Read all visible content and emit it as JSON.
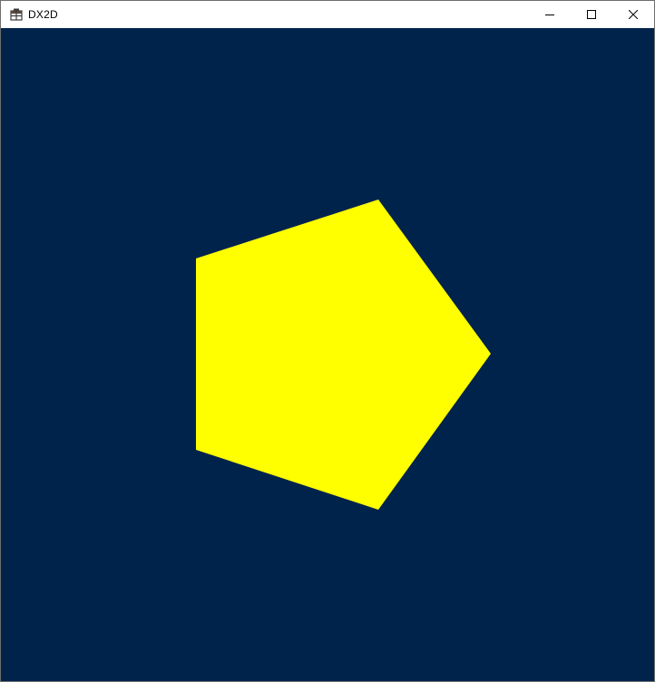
{
  "window": {
    "title": "DX2D",
    "icon": "app-window-icon",
    "buttons": {
      "minimize": {
        "icon": "minimize-icon"
      },
      "maximize": {
        "icon": "maximize-icon"
      },
      "close": {
        "icon": "close-icon"
      }
    }
  },
  "scene": {
    "background_color": "#00234c",
    "shape": {
      "type": "pentagon",
      "sides": 5,
      "fill_color": "#ffff00"
    }
  }
}
